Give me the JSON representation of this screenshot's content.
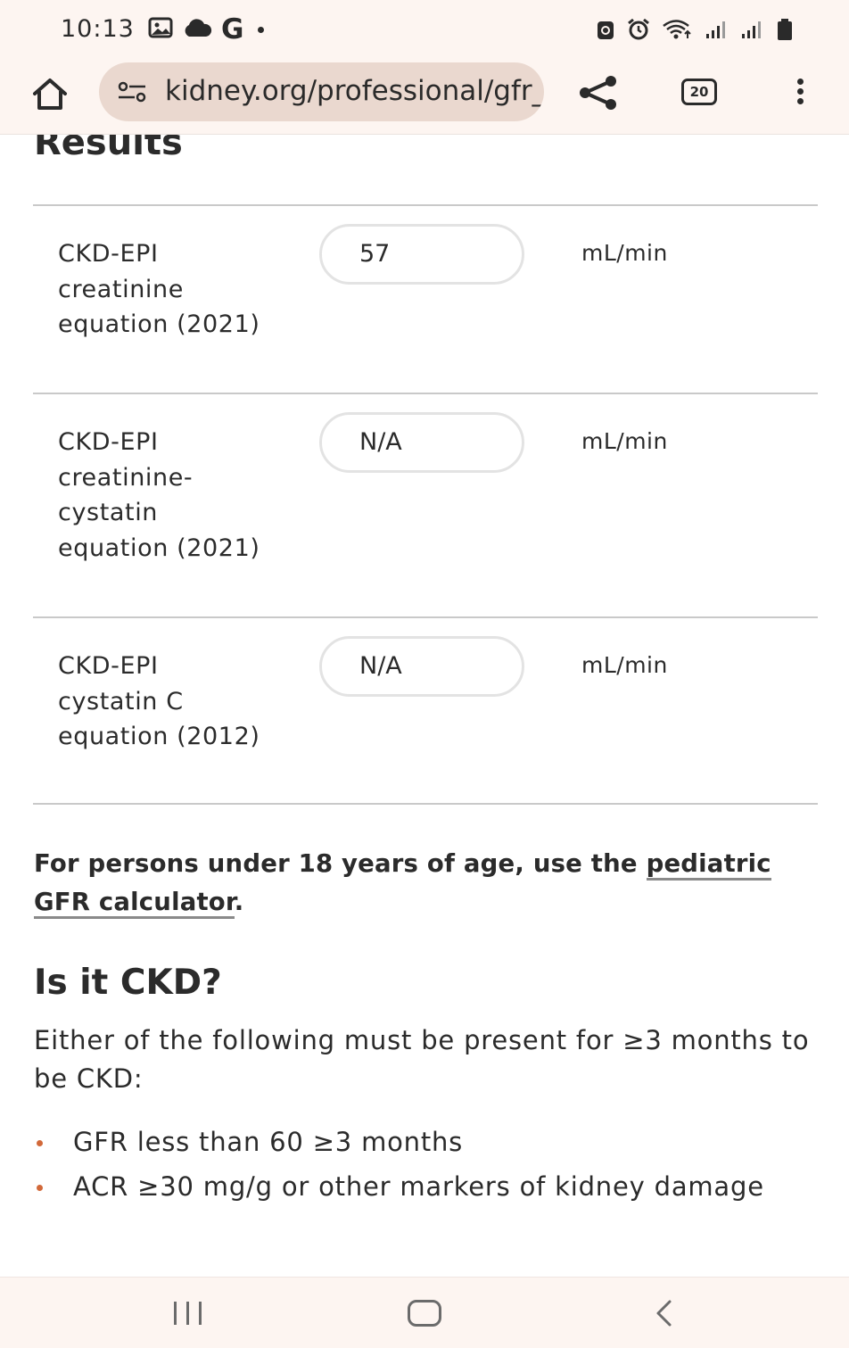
{
  "status_bar": {
    "time": "10:13",
    "google_letter": "G"
  },
  "browser": {
    "url": "kidney.org/professional/gfr_calculator",
    "tab_count": "20"
  },
  "results": {
    "heading": "Results",
    "rows": [
      {
        "label": "CKD-EPI creatinine equation (2021)",
        "value": "57",
        "unit": "mL/min"
      },
      {
        "label": "CKD-EPI creatinine-cystatin equation (2021)",
        "value": "N/A",
        "unit": "mL/min"
      },
      {
        "label": "CKD-EPI cystatin C equation (2012)",
        "value": "N/A",
        "unit": "mL/min"
      }
    ]
  },
  "pediatric": {
    "prefix": "For persons under 18 years of age, use the ",
    "link_text": "pediatric GFR calculator",
    "suffix": "."
  },
  "ckd": {
    "heading": "Is it CKD?",
    "description": "Either of the following must be present for ≥3 months to be CKD:",
    "criteria": [
      "GFR less than 60 ≥3 months",
      "ACR ≥30 mg/g or other markers of kidney damage"
    ]
  },
  "colors": {
    "chrome_background": "#fdf5f1",
    "url_bar_background": "#ead8cf",
    "bullet_accent": "#d2693a",
    "text": "#2b2b2b",
    "divider": "#c9c9c9"
  },
  "icons": {
    "status_left": [
      "gallery-icon",
      "cloud-icon",
      "google-icon",
      "notification-dot-icon"
    ],
    "status_right": [
      "vpn-lock-icon",
      "alarm-icon",
      "wifi-icon",
      "signal-icon",
      "signal-icon",
      "battery-icon"
    ],
    "toolbar": [
      "home-icon",
      "site-settings-icon",
      "share-icon",
      "tabs-icon",
      "more-vert-icon"
    ],
    "nav": [
      "recents-icon",
      "home-nav-icon",
      "back-icon"
    ]
  }
}
